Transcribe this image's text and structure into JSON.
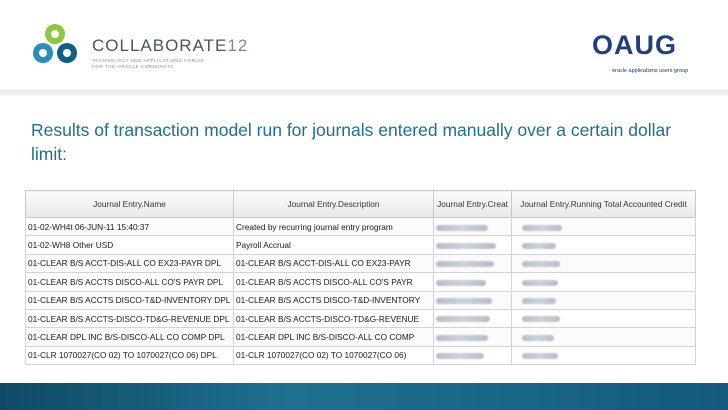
{
  "header": {
    "brand_name": "COLLABORATE",
    "brand_year": "12",
    "brand_tagline_1": "TECHNOLOGY AND APPLICATIONS FORUM",
    "brand_tagline_2": "FOR THE ORACLE COMMUNITY",
    "oaug_wordmark": "OAUG",
    "oaug_tagline": "oracle applications users group"
  },
  "slide": {
    "heading": "Results of transaction model run for journals entered manually over a certain dollar limit:"
  },
  "table": {
    "columns": [
      "Journal Entry.Name",
      "Journal Entry.Description",
      "Journal Entry.Creat",
      "Journal Entry.Running Total Accounted Credit"
    ],
    "rows": [
      {
        "name": "01-02-WH4t 06-JUN-11 15:40:37",
        "description": "Created by recurring journal entry program"
      },
      {
        "name": "01-02-WH8 Other USD",
        "description": "Payroll Accrual"
      },
      {
        "name": "01-CLEAR B/S ACCT-DIS-ALL CO EX23-PAYR DPL",
        "description": "01-CLEAR B/S ACCT-DIS-ALL CO EX23-PAYR"
      },
      {
        "name": "01-CLEAR B/S ACCTS DISCO-ALL CO'S PAYR DPL",
        "description": "01-CLEAR B/S ACCTS DISCO-ALL CO'S PAYR"
      },
      {
        "name": "01-CLEAR B/S ACCTS DISCO-T&D-INVENTORY DPL",
        "description": "01-CLEAR B/S ACCTS DISCO-T&D-INVENTORY"
      },
      {
        "name": "01-CLEAR B/S ACCTS-DISCO-TD&G-REVENUE DPL",
        "description": "01-CLEAR B/S ACCTS-DISCO-TD&G-REVENUE"
      },
      {
        "name": "01-CLEAR DPL INC B/S-DISCO-ALL CO COMP DPL",
        "description": "01-CLEAR DPL INC B/S-DISCO-ALL CO COMP"
      },
      {
        "name": "01-CLR 1070027(CO 02) TO 1070027(CO 06) DPL",
        "description": "01-CLR 1070027(CO 02) TO 1070027(CO 06)"
      }
    ]
  },
  "colors": {
    "heading": "#1b6f9b",
    "footer": "#1f7090",
    "oaug_blue": "#1f3f83"
  }
}
